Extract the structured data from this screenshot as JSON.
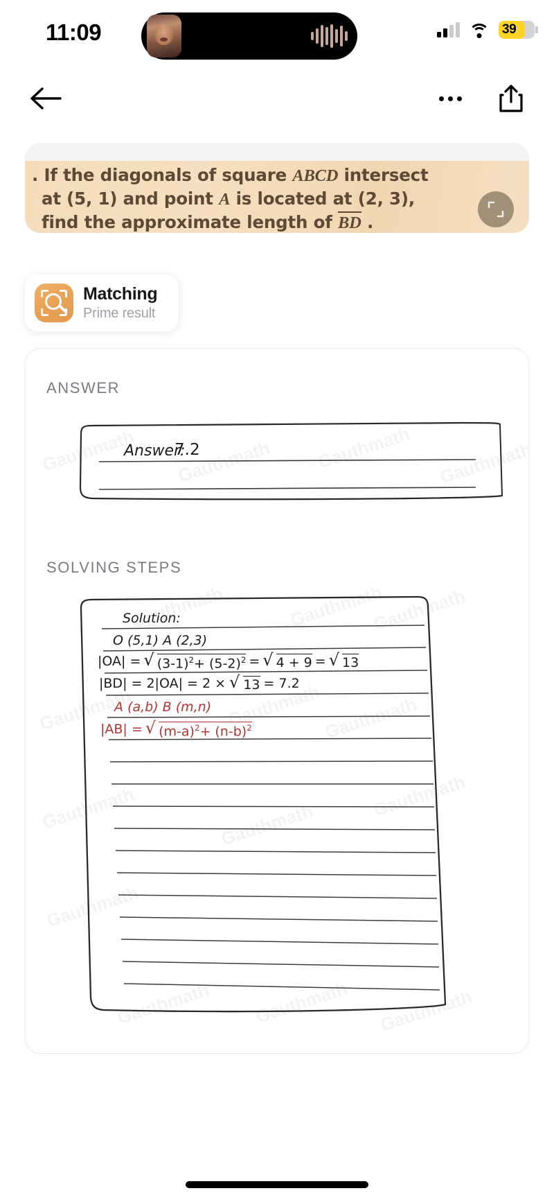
{
  "status_bar": {
    "time": "11:09",
    "battery_percent": "39",
    "icons": {
      "signal": "cellular-signal-icon",
      "wifi": "wifi-icon",
      "battery": "battery-icon",
      "call_avatar": "call-avatar",
      "call_waveform": "audio-waveform-icon"
    }
  },
  "nav": {
    "back": "back-arrow-icon",
    "more": "more-options-icon",
    "share": "share-icon"
  },
  "question": {
    "line1_a": "If the diagonals of square ",
    "line1_b": "ABCD",
    "line1_c": " intersect",
    "line2_a": "at (5, 1) and point ",
    "line2_b": "A",
    "line2_c": " is located at (2, 3),",
    "line3_a": "find the approximate length of ",
    "line3_b": "BD",
    "line3_c": " .",
    "bullet": ".",
    "expand_icon": "expand-fullscreen-icon"
  },
  "matching": {
    "title": "Matching",
    "subtitle": "Prime result",
    "icon": "scan-search-icon"
  },
  "result": {
    "answer_label": "ANSWER",
    "steps_label": "SOLVING STEPS",
    "answer_prefix": "Answer:",
    "answer_value": "7.2",
    "solution_title": "Solution:",
    "step_points": "O (5,1)    A (2,3)",
    "step_oa_lhs": "|OA| =",
    "step_oa_r1": "(3-1)",
    "step_oa_r1b": "+ (5-2)",
    "step_oa_eq": "=",
    "step_oa_r2": "4 + 9",
    "step_oa_eq2": "=",
    "step_oa_r3": "13",
    "step_bd": "|BD| = 2|OA| = 2 ×",
    "step_bd_r": "13",
    "step_bd_end": "= 7.2",
    "step_red_points": "A (a,b)   B (m,n)",
    "step_red_lhs": "|AB| =",
    "step_red_r1": "(m-a)",
    "step_red_r1b": "+ (n-b)",
    "exp2": "2",
    "watermark_text": "Gauthmath"
  },
  "colors": {
    "accent_orange": "#e8a155",
    "battery_yellow": "#FFD426",
    "label_gray": "#7b7b85",
    "red_ink": "#b03434",
    "question_bg": "#f2d6b2"
  }
}
